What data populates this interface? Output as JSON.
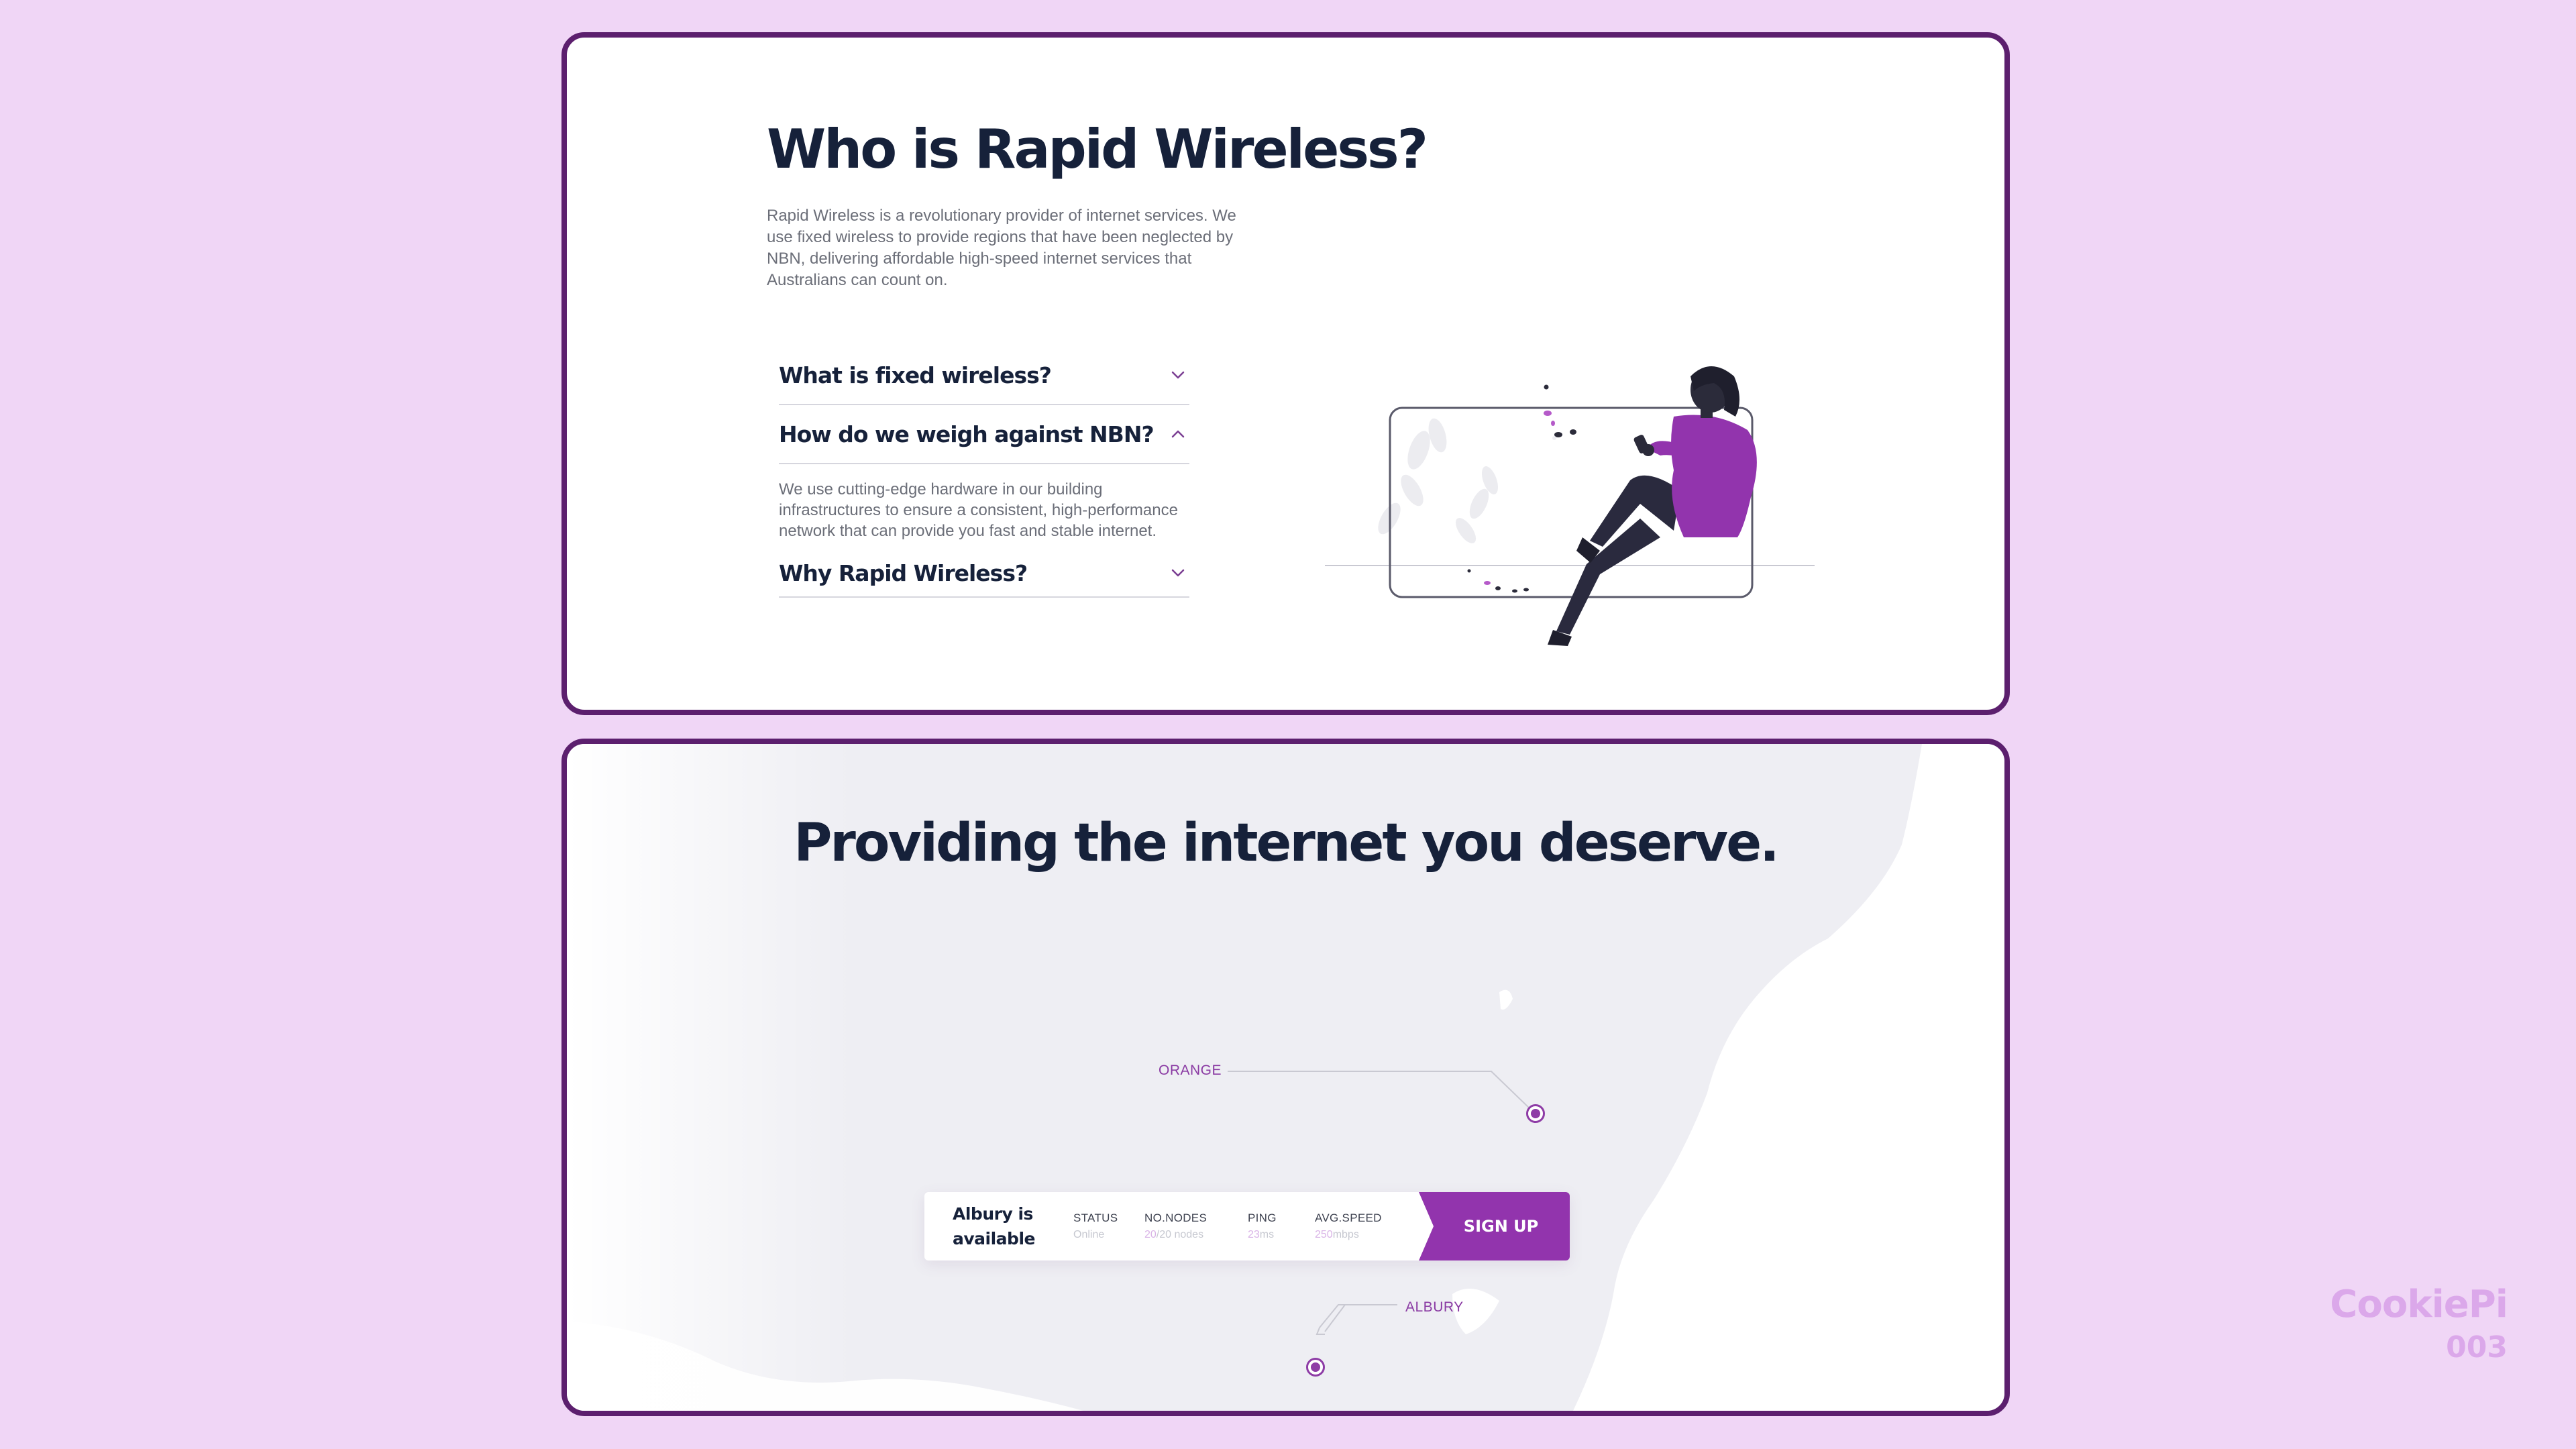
{
  "about": {
    "title": "Who is Rapid Wireless?",
    "intro": "Rapid Wireless is a revolutionary provider of internet services. We use fixed wireless to provide regions that have been neglected by NBN, delivering affordable high-speed internet services that Australians can count on.",
    "faq": [
      {
        "question": "What is fixed wireless?",
        "expanded": false,
        "answer": ""
      },
      {
        "question": "How do we weigh against NBN?",
        "expanded": true,
        "answer": "We use cutting-edge hardware in our building infrastructures to ensure a consistent, high-performance network that can provide you fast and stable internet."
      },
      {
        "question": "Why Rapid Wireless?",
        "expanded": false,
        "answer": ""
      }
    ]
  },
  "coverage": {
    "title": "Providing the internet you deserve.",
    "cities": [
      {
        "name": "ORANGE"
      },
      {
        "name": "ALBURY"
      }
    ],
    "status_bar": {
      "headline": "Albury is available",
      "stats": [
        {
          "label": "STATUS",
          "value_highlight": "",
          "value_rest": "Online"
        },
        {
          "label": "NO.NODES",
          "value_highlight": "20",
          "value_rest": "/20 nodes"
        },
        {
          "label": "PING",
          "value_highlight": "23",
          "value_rest": "ms"
        },
        {
          "label": "AVG.SPEED",
          "value_highlight": "250",
          "value_rest": "mbps"
        }
      ],
      "cta": "SIGN UP"
    }
  },
  "brand": {
    "name": "CookiePi",
    "number": "003"
  },
  "colors": {
    "page_background": "#f0d6f6",
    "card_border": "#5c1f6e",
    "heading": "#16213a",
    "accent": "#9234ad",
    "muted_text": "#6b6e78",
    "brand": "#dba8ea"
  }
}
